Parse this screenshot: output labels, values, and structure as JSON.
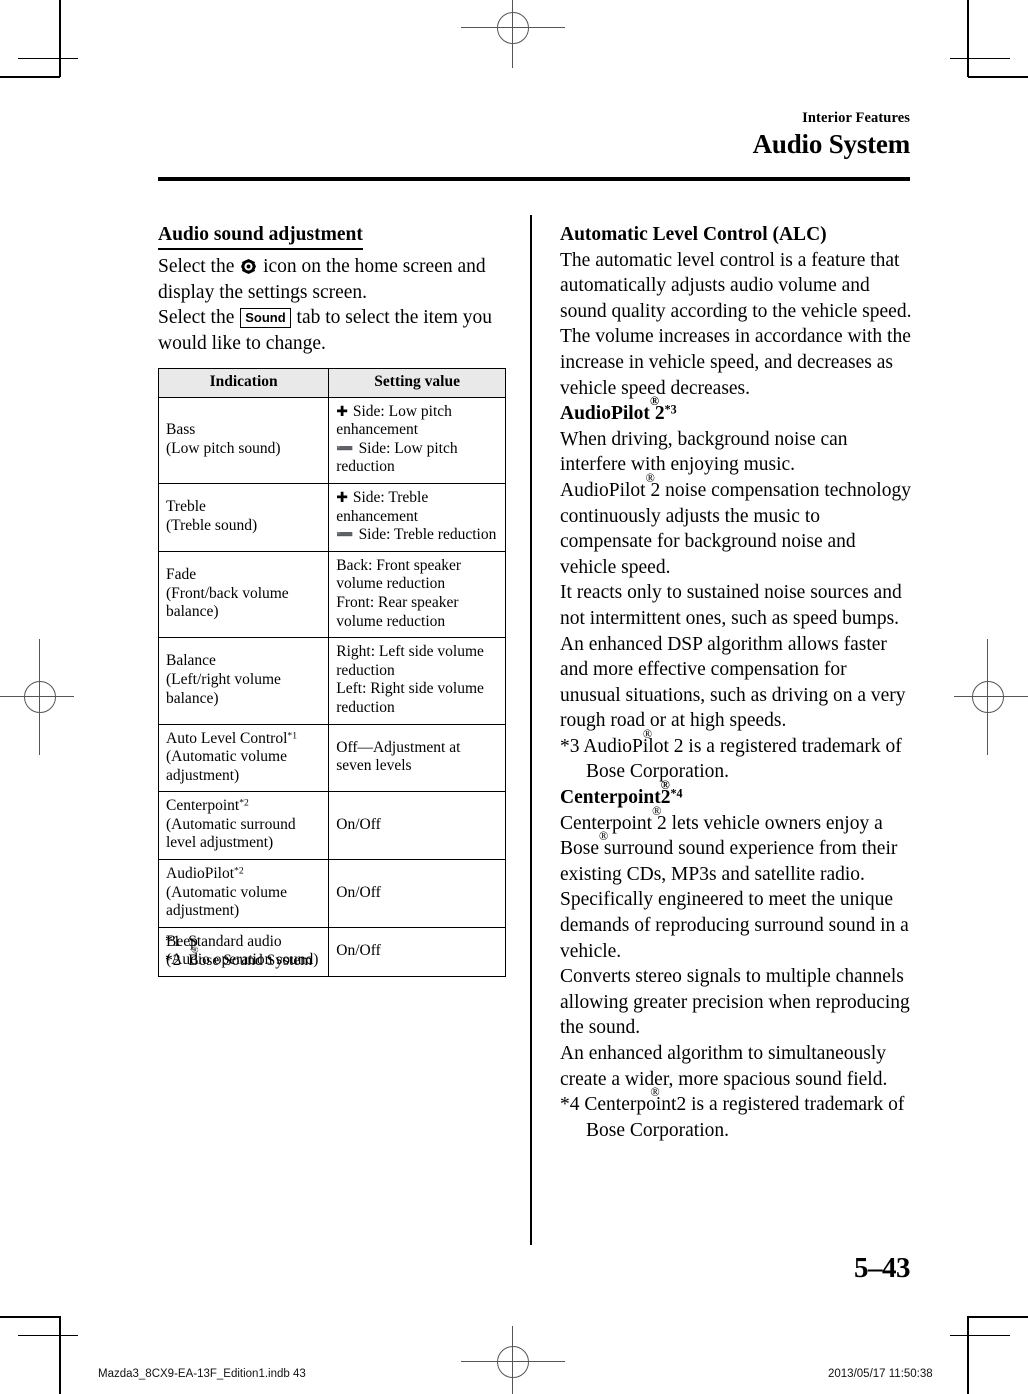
{
  "page": {
    "running_head_chapter": "Interior Features",
    "running_head_section": "Audio System",
    "page_number": "5–43"
  },
  "left_column": {
    "heading": "Audio sound adjustment",
    "para1_before_icon": "Select the ",
    "para1_after_icon": " icon on the home screen and display the settings screen.",
    "para2_before_badge": "Select the ",
    "badge_label": "Sound",
    "para2_after_badge": " tab to select the item you would like to change."
  },
  "table": {
    "headers": [
      "Indication",
      "Setting value"
    ],
    "rows": [
      {
        "indication_line1": "Bass",
        "indication_line2": "(Low pitch sound)",
        "setting_lines": [
          {
            "glyph": "plus",
            "text": "Side: Low pitch enhancement"
          },
          {
            "glyph": "minus",
            "text": "Side: Low pitch reduction"
          }
        ]
      },
      {
        "indication_line1": "Treble",
        "indication_line2": "(Treble sound)",
        "setting_lines": [
          {
            "glyph": "plus",
            "text": "Side: Treble enhancement"
          },
          {
            "glyph": "minus",
            "text": "Side: Treble reduction"
          }
        ]
      },
      {
        "indication_line1": "Fade",
        "indication_line2": "(Front/back volume balance)",
        "setting_lines": [
          {
            "glyph": "none",
            "text": "Back: Front speaker volume reduction"
          },
          {
            "glyph": "none",
            "text": "Front: Rear speaker volume reduction"
          }
        ]
      },
      {
        "indication_line1": "Balance",
        "indication_line2": "(Left/right volume balance)",
        "setting_lines": [
          {
            "glyph": "none",
            "text": "Right: Left side volume reduction"
          },
          {
            "glyph": "none",
            "text": "Left: Right side volume reduction"
          }
        ]
      },
      {
        "indication_line1": "Auto Level Control",
        "indication_footnote": "*1",
        "indication_line2": "(Automatic volume adjustment)",
        "setting_lines": [
          {
            "glyph": "none",
            "text": "Off—Adjustment at seven levels"
          }
        ]
      },
      {
        "indication_line1": "Centerpoint",
        "indication_footnote": "*2",
        "indication_line2": "(Automatic surround level adjustment)",
        "setting_lines": [
          {
            "glyph": "none",
            "text": "On/Off"
          }
        ]
      },
      {
        "indication_line1": "AudioPilot",
        "indication_footnote": "*2",
        "indication_line2": "(Automatic volume adjustment)",
        "setting_lines": [
          {
            "glyph": "none",
            "text": "On/Off"
          }
        ]
      },
      {
        "indication_line1": "Beep",
        "indication_line2": "(Audio operation sound)",
        "setting_lines": [
          {
            "glyph": "none",
            "text": "On/Off"
          }
        ]
      }
    ],
    "footnotes": [
      {
        "marker": "*1",
        "text": "Standard audio"
      },
      {
        "marker": "*2",
        "text_before_reg": "Bose",
        "text_after_reg": " Sound System"
      }
    ]
  },
  "right_column": {
    "alc": {
      "heading": "Automatic Level Control (ALC)",
      "body": "The automatic level control is a feature that automatically adjusts audio volume and sound quality according to the vehicle speed. The volume increases in accordance with the increase in vehicle speed, and decreases as vehicle speed decreases."
    },
    "audiopilot": {
      "heading_name": "AudioPilot",
      "heading_after_reg": " 2",
      "heading_footnote": "*3",
      "para1": "When driving, background noise can interfere with enjoying music.",
      "para2_before_reg": "AudioPilot",
      "para2_after_reg": " 2 noise compensation technology continuously adjusts the music to compensate for background noise and vehicle speed.",
      "para3": "It reacts only to sustained noise sources and not intermittent ones, such as speed bumps.",
      "para4": "An enhanced DSP algorithm allows faster and more effective compensation for unusual situations, such as driving on a very rough road or at high speeds.",
      "footnote_marker": "*3 AudioPilot",
      "footnote_after_reg": " 2 is a registered trademark of Bose Corporation."
    },
    "centerpoint": {
      "heading_name": "Centerpoint",
      "heading_after_reg": "2",
      "heading_footnote": "*4",
      "para1_before_reg": "Centerpoint",
      "para1_mid": " 2 lets vehicle owners enjoy a Bose",
      "para1_after": " surround sound experience from their existing CDs, MP3s and satellite radio.",
      "para2": "Specifically engineered to meet the unique demands of reproducing surround sound in a vehicle.",
      "para3": "Converts stereo signals to multiple channels allowing greater precision when reproducing the sound.",
      "para4": "An enhanced algorithm to simultaneously create a wider, more spacious sound field.",
      "footnote_marker": "*4 Centerpoint",
      "footnote_after_reg": "2 is a registered trademark of Bose Corporation."
    }
  },
  "print_footer": {
    "left": "Mazda3_8CX9-EA-13F_Edition1.indb   43",
    "right": "2013/05/17   11:50:38"
  }
}
